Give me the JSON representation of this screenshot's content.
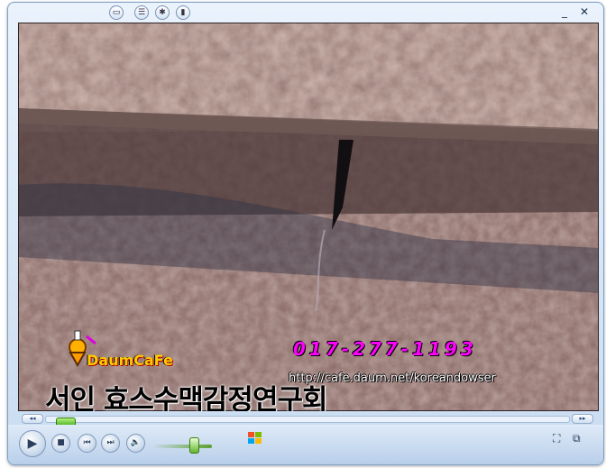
{
  "titlebar": {
    "icons": [
      "folder-icon",
      "list-icon",
      "visualizer-icon",
      "equalizer-icon"
    ],
    "minimize": "_",
    "close": "✕"
  },
  "video": {
    "overlay": {
      "phone": "017-277-1193",
      "url": "http://cafe.daum.net/koreandowser",
      "title": "서인 효스수맥감정연구회",
      "brand": "DaumCaFe"
    }
  },
  "seekbar": {
    "position_fraction": 0.02,
    "left_arrow": "◂◂",
    "right_arrow": "▸▸"
  },
  "controls": {
    "play": "▶",
    "stop": "■",
    "previous": "⏮",
    "next": "⏭",
    "mute": "🔈",
    "volume_fraction": 0.7,
    "fullscreen": "⛶",
    "switch_mode": "⧉"
  },
  "colors": {
    "frame": "#c9dcf1",
    "accent_green": "#3ea818"
  }
}
